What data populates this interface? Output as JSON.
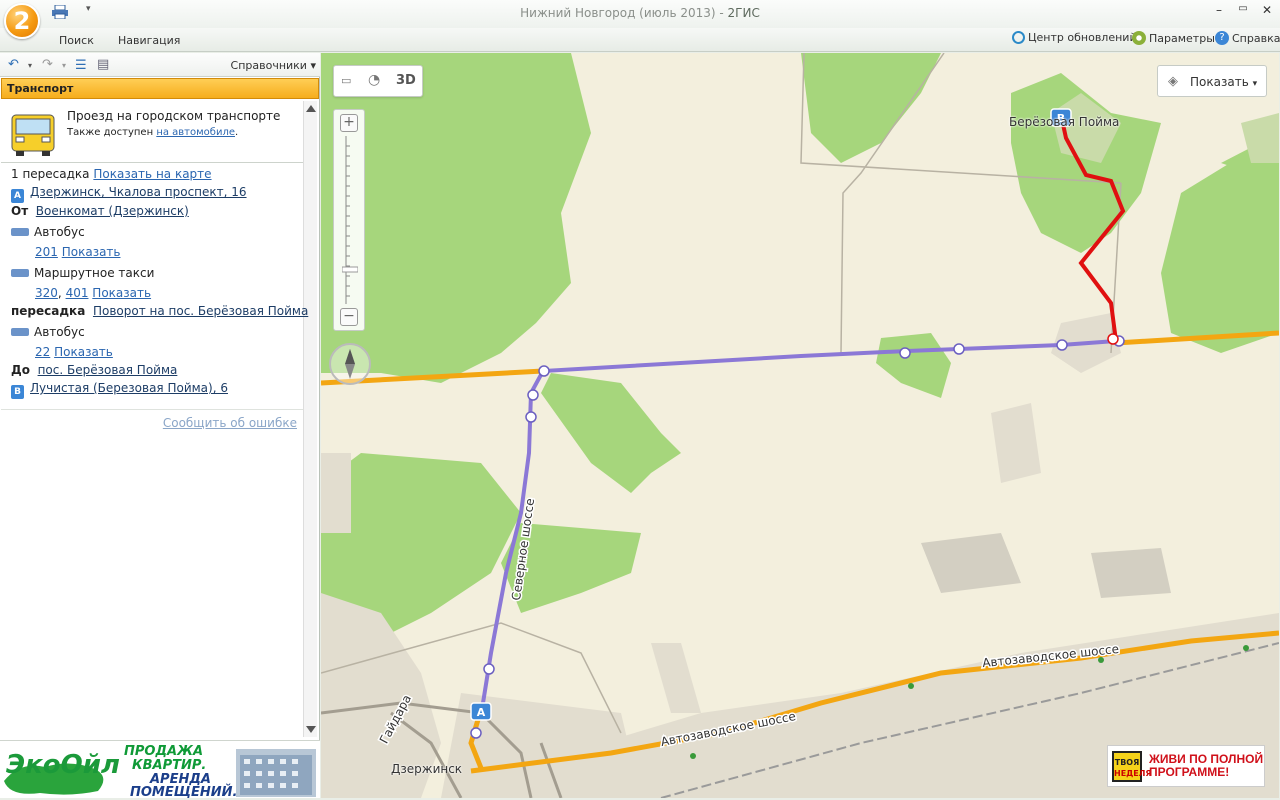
{
  "app": {
    "logo": "2",
    "title": "Нижний Новгород (июль 2013) -",
    "brand": "2ГИС",
    "icons": [
      "print-icon",
      "minimize-icon",
      "maximize-icon",
      "close-icon"
    ]
  },
  "menu": {
    "search": "Поиск",
    "navigation": "Навигация",
    "updates": "Центр обновлений",
    "settings": "Параметры",
    "help": "Справка"
  },
  "panel": {
    "directories": "Справочники",
    "section": "Транспорт",
    "mode_title": "Проезд на городском транспорте",
    "mode_sub_prefix": "Также доступен",
    "mode_sub_link": "на автомобиле",
    "transfers": "1 пересадка",
    "show_on_map": "Показать на карте",
    "point_a_badge": "A",
    "point_a": "Дзержинск, Чкалова проспект, 16",
    "from_label": "От",
    "from_stop": "Военкомат (Дзержинск)",
    "bus1_label": "Автобус",
    "bus1_route": "201",
    "show": "Показать",
    "taxi_label": "Маршрутное такси",
    "taxi_route1": "320",
    "taxi_sep": ",",
    "taxi_route2": "401",
    "transfer_label": "пересадка",
    "transfer_stop": "Поворот на пос. Берёзовая Пойма",
    "bus2_label": "Автобус",
    "bus2_route": "22",
    "to_label": "До",
    "to_stop": "пос. Берёзовая Пойма",
    "point_b_badge": "B",
    "point_b": "Лучистая (Березовая Пойма), 6",
    "report": "Сообщить об ошибке"
  },
  "ad_left": {
    "brand": "ЭкоОйл",
    "l1": "ПРОДАЖА",
    "l2": "КВАРТИР.",
    "l3": "АРЕНДА",
    "l4": "ПОМЕЩЕНИЙ."
  },
  "map": {
    "mode_3d": "3D",
    "show_button": "Показать",
    "zoom_in": "+",
    "zoom_out": "−",
    "label_berezovaya": "Берёзовая Пойма",
    "label_severnoe": "Северное шоссе",
    "label_avtozavodskoe1": "Автозаводское шоссе",
    "label_avtozavodskoe2": "Автозаводское шоссе",
    "label_gaidara": "Гайдара",
    "label_dzerzhinsk": "Дзержинск",
    "marker_a": "A",
    "marker_b": "B",
    "route_color": "#8b78d6",
    "walk_color": "#e01010",
    "road_color": "#f3a612"
  },
  "ad_right": {
    "logo_l1": "ТВОЯ",
    "logo_l2": "НЕДЕЛЯ",
    "text_l1": "ЖИВИ ПО ПОЛНОЙ",
    "text_l2": "ПРОГРАММЕ!"
  }
}
